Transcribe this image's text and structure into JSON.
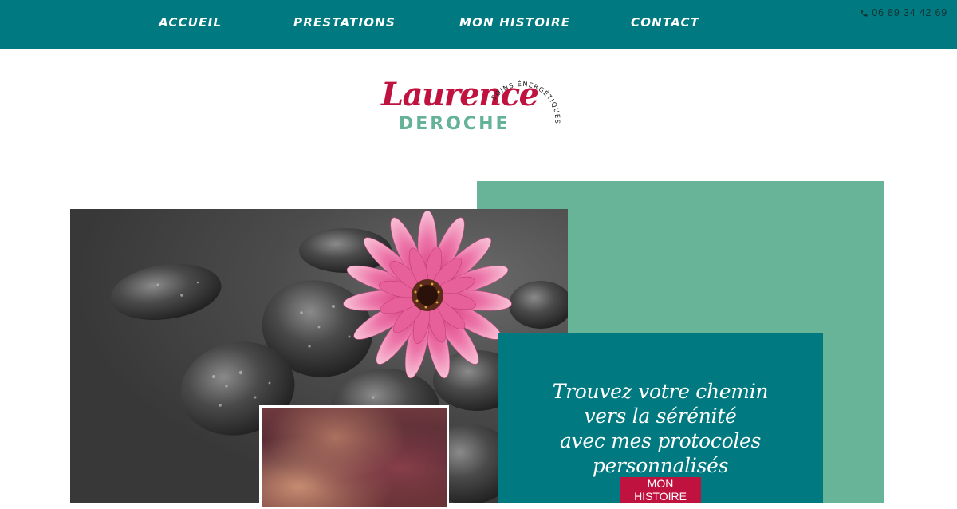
{
  "nav": {
    "items": [
      {
        "label": "ACCUEIL"
      },
      {
        "label": "PRESTATIONS"
      },
      {
        "label": "MON HISTOIRE"
      },
      {
        "label": "CONTACT"
      }
    ],
    "phone": "06 89 34 42 69",
    "phone_icon": "phone-icon"
  },
  "logo": {
    "first_name": "Laurence",
    "last_name": "DEROCHE",
    "tagline": "SOINS ÉNERGÉTIQUES"
  },
  "hero": {
    "tagline_lines": [
      "Trouvez votre chemin",
      "vers la sérénité",
      "avec mes protocoles personnalisés"
    ],
    "cta_label": "MON HISTOIRE"
  },
  "colors": {
    "teal": "#007a80",
    "green": "#67b499",
    "crimson": "#c0123f"
  }
}
